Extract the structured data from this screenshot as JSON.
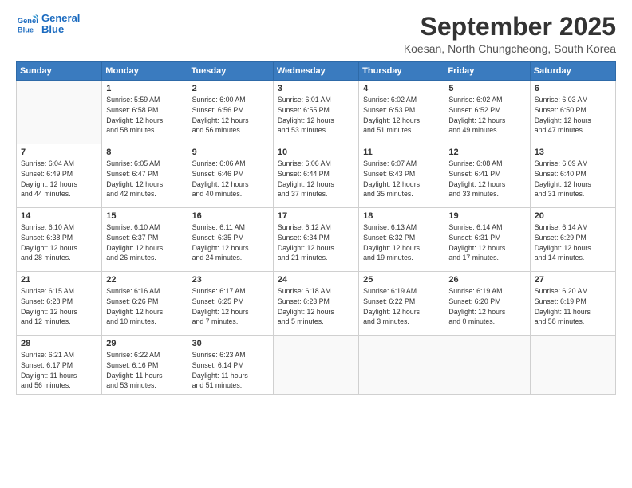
{
  "header": {
    "logo": {
      "line1": "General",
      "line2": "Blue"
    },
    "title": "September 2025",
    "subtitle": "Koesan, North Chungcheong, South Korea"
  },
  "calendar": {
    "days_of_week": [
      "Sunday",
      "Monday",
      "Tuesday",
      "Wednesday",
      "Thursday",
      "Friday",
      "Saturday"
    ],
    "weeks": [
      [
        {
          "day": "",
          "info": ""
        },
        {
          "day": "1",
          "info": "Sunrise: 5:59 AM\nSunset: 6:58 PM\nDaylight: 12 hours\nand 58 minutes."
        },
        {
          "day": "2",
          "info": "Sunrise: 6:00 AM\nSunset: 6:56 PM\nDaylight: 12 hours\nand 56 minutes."
        },
        {
          "day": "3",
          "info": "Sunrise: 6:01 AM\nSunset: 6:55 PM\nDaylight: 12 hours\nand 53 minutes."
        },
        {
          "day": "4",
          "info": "Sunrise: 6:02 AM\nSunset: 6:53 PM\nDaylight: 12 hours\nand 51 minutes."
        },
        {
          "day": "5",
          "info": "Sunrise: 6:02 AM\nSunset: 6:52 PM\nDaylight: 12 hours\nand 49 minutes."
        },
        {
          "day": "6",
          "info": "Sunrise: 6:03 AM\nSunset: 6:50 PM\nDaylight: 12 hours\nand 47 minutes."
        }
      ],
      [
        {
          "day": "7",
          "info": "Sunrise: 6:04 AM\nSunset: 6:49 PM\nDaylight: 12 hours\nand 44 minutes."
        },
        {
          "day": "8",
          "info": "Sunrise: 6:05 AM\nSunset: 6:47 PM\nDaylight: 12 hours\nand 42 minutes."
        },
        {
          "day": "9",
          "info": "Sunrise: 6:06 AM\nSunset: 6:46 PM\nDaylight: 12 hours\nand 40 minutes."
        },
        {
          "day": "10",
          "info": "Sunrise: 6:06 AM\nSunset: 6:44 PM\nDaylight: 12 hours\nand 37 minutes."
        },
        {
          "day": "11",
          "info": "Sunrise: 6:07 AM\nSunset: 6:43 PM\nDaylight: 12 hours\nand 35 minutes."
        },
        {
          "day": "12",
          "info": "Sunrise: 6:08 AM\nSunset: 6:41 PM\nDaylight: 12 hours\nand 33 minutes."
        },
        {
          "day": "13",
          "info": "Sunrise: 6:09 AM\nSunset: 6:40 PM\nDaylight: 12 hours\nand 31 minutes."
        }
      ],
      [
        {
          "day": "14",
          "info": "Sunrise: 6:10 AM\nSunset: 6:38 PM\nDaylight: 12 hours\nand 28 minutes."
        },
        {
          "day": "15",
          "info": "Sunrise: 6:10 AM\nSunset: 6:37 PM\nDaylight: 12 hours\nand 26 minutes."
        },
        {
          "day": "16",
          "info": "Sunrise: 6:11 AM\nSunset: 6:35 PM\nDaylight: 12 hours\nand 24 minutes."
        },
        {
          "day": "17",
          "info": "Sunrise: 6:12 AM\nSunset: 6:34 PM\nDaylight: 12 hours\nand 21 minutes."
        },
        {
          "day": "18",
          "info": "Sunrise: 6:13 AM\nSunset: 6:32 PM\nDaylight: 12 hours\nand 19 minutes."
        },
        {
          "day": "19",
          "info": "Sunrise: 6:14 AM\nSunset: 6:31 PM\nDaylight: 12 hours\nand 17 minutes."
        },
        {
          "day": "20",
          "info": "Sunrise: 6:14 AM\nSunset: 6:29 PM\nDaylight: 12 hours\nand 14 minutes."
        }
      ],
      [
        {
          "day": "21",
          "info": "Sunrise: 6:15 AM\nSunset: 6:28 PM\nDaylight: 12 hours\nand 12 minutes."
        },
        {
          "day": "22",
          "info": "Sunrise: 6:16 AM\nSunset: 6:26 PM\nDaylight: 12 hours\nand 10 minutes."
        },
        {
          "day": "23",
          "info": "Sunrise: 6:17 AM\nSunset: 6:25 PM\nDaylight: 12 hours\nand 7 minutes."
        },
        {
          "day": "24",
          "info": "Sunrise: 6:18 AM\nSunset: 6:23 PM\nDaylight: 12 hours\nand 5 minutes."
        },
        {
          "day": "25",
          "info": "Sunrise: 6:19 AM\nSunset: 6:22 PM\nDaylight: 12 hours\nand 3 minutes."
        },
        {
          "day": "26",
          "info": "Sunrise: 6:19 AM\nSunset: 6:20 PM\nDaylight: 12 hours\nand 0 minutes."
        },
        {
          "day": "27",
          "info": "Sunrise: 6:20 AM\nSunset: 6:19 PM\nDaylight: 11 hours\nand 58 minutes."
        }
      ],
      [
        {
          "day": "28",
          "info": "Sunrise: 6:21 AM\nSunset: 6:17 PM\nDaylight: 11 hours\nand 56 minutes."
        },
        {
          "day": "29",
          "info": "Sunrise: 6:22 AM\nSunset: 6:16 PM\nDaylight: 11 hours\nand 53 minutes."
        },
        {
          "day": "30",
          "info": "Sunrise: 6:23 AM\nSunset: 6:14 PM\nDaylight: 11 hours\nand 51 minutes."
        },
        {
          "day": "",
          "info": ""
        },
        {
          "day": "",
          "info": ""
        },
        {
          "day": "",
          "info": ""
        },
        {
          "day": "",
          "info": ""
        }
      ]
    ]
  }
}
